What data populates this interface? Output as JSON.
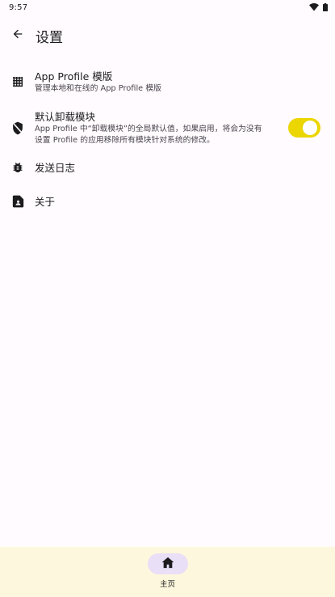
{
  "status_bar": {
    "time": "9:57",
    "icons": [
      "wifi-icon",
      "battery-icon"
    ]
  },
  "top_bar": {
    "title": "设置",
    "back_icon": "arrow-back-icon"
  },
  "settings": {
    "app_profile_template": {
      "icon": "grid-icon",
      "title": "App Profile 模版",
      "summary": "管理本地和在线的 App Profile 模版"
    },
    "default_uninstall_modules": {
      "icon": "shield-off-icon",
      "title": "默认卸载模块",
      "summary_line1": "App Profile 中“卸载模块”的全局默认值，如果启用，将会为没有",
      "summary_line2": "设置 Profile 的应用移除所有模块针对系统的修改。",
      "toggle_on": true
    },
    "send_log": {
      "icon": "bug-icon",
      "title": "发送日志"
    },
    "about": {
      "icon": "contact-page-icon",
      "title": "关于"
    }
  },
  "bottom_nav": {
    "items": [
      {
        "label": "主页",
        "icon": "home-icon",
        "selected": true
      }
    ]
  },
  "colors": {
    "background": "#fffbfe",
    "toggle_track": "#ebd600",
    "nav_background": "#fdf7dd",
    "nav_indicator": "#e9dff6"
  }
}
